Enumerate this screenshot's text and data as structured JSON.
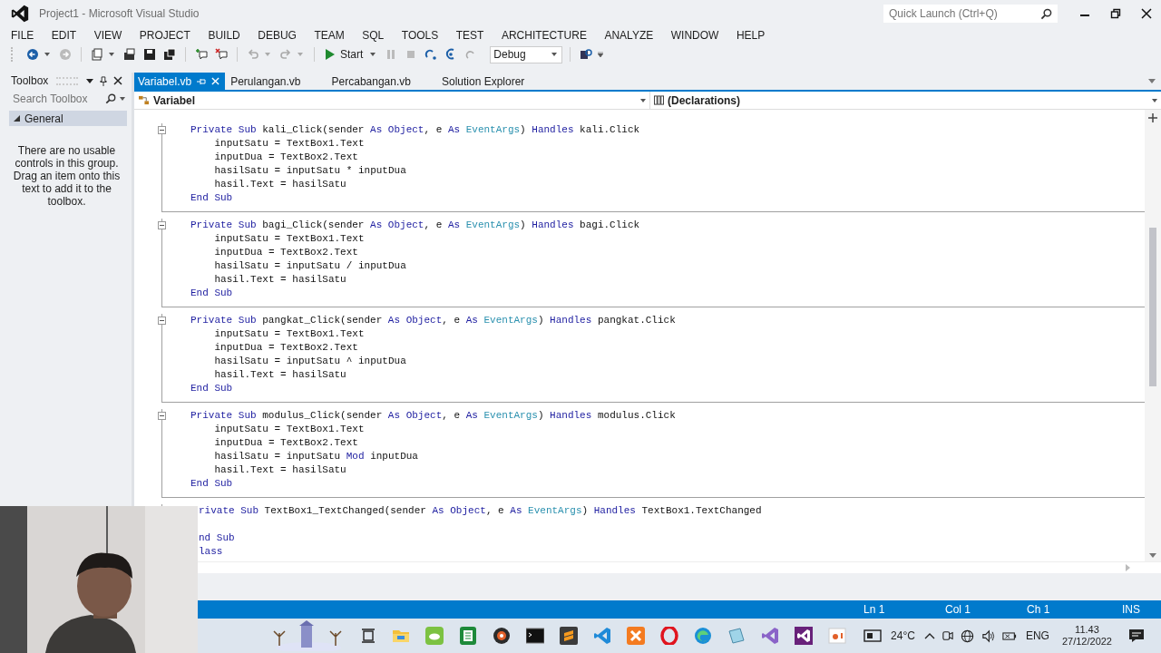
{
  "window": {
    "title": "Project1 - Microsoft Visual Studio"
  },
  "quick_launch": {
    "placeholder": "Quick Launch (Ctrl+Q)"
  },
  "menu": [
    "FILE",
    "EDIT",
    "VIEW",
    "PROJECT",
    "BUILD",
    "DEBUG",
    "TEAM",
    "SQL",
    "TOOLS",
    "TEST",
    "ARCHITECTURE",
    "ANALYZE",
    "WINDOW",
    "HELP"
  ],
  "toolbar": {
    "start_label": "Start",
    "configuration": "Debug"
  },
  "toolbox": {
    "title": "Toolbox",
    "search": {
      "placeholder": "Search Toolbox"
    },
    "group": {
      "label": "General",
      "expanded": true
    },
    "empty_message": "There are no usable controls in this group. Drag an item onto this text to add it to the toolbox."
  },
  "tabs": [
    {
      "label": "Variabel.vb",
      "selected": true
    },
    {
      "label": "Perulangan.vb",
      "selected": false
    },
    {
      "label": "Percabangan.vb",
      "selected": false
    },
    {
      "label": "Solution Explorer",
      "selected": false
    }
  ],
  "nav_bar": {
    "type": "Variabel",
    "member": "(Declarations)"
  },
  "code_blocks": [
    {
      "lines": [
        {
          "kind": "head",
          "tokens": [
            {
              "kind": "keyword",
              "text": "Private Sub"
            },
            {
              "kind": "plain",
              "text": " kali_Click(sender "
            },
            {
              "kind": "keyword",
              "text": "As Object"
            },
            {
              "kind": "plain",
              "text": ", e "
            },
            {
              "kind": "keyword",
              "text": "As"
            },
            {
              "kind": "type",
              "text": " EventArgs"
            },
            {
              "kind": "plain",
              "text": ") "
            },
            {
              "kind": "keyword",
              "text": "Handles"
            },
            {
              "kind": "plain",
              "text": " kali.Click"
            }
          ]
        },
        {
          "kind": "body",
          "tokens": [
            {
              "kind": "plain",
              "text": "inputSatu = TextBox1.Text"
            }
          ]
        },
        {
          "kind": "body",
          "tokens": [
            {
              "kind": "plain",
              "text": "inputDua = TextBox2.Text"
            }
          ]
        },
        {
          "kind": "body",
          "tokens": [
            {
              "kind": "plain",
              "text": "hasilSatu = inputSatu * inputDua"
            }
          ]
        },
        {
          "kind": "body",
          "tokens": [
            {
              "kind": "plain",
              "text": "hasil.Text = hasilSatu"
            }
          ]
        },
        {
          "kind": "end",
          "tokens": [
            {
              "kind": "keyword",
              "text": "End Sub"
            }
          ]
        }
      ]
    },
    {
      "lines": [
        {
          "kind": "head",
          "tokens": [
            {
              "kind": "keyword",
              "text": "Private Sub"
            },
            {
              "kind": "plain",
              "text": " bagi_Click(sender "
            },
            {
              "kind": "keyword",
              "text": "As Object"
            },
            {
              "kind": "plain",
              "text": ", e "
            },
            {
              "kind": "keyword",
              "text": "As"
            },
            {
              "kind": "type",
              "text": " EventArgs"
            },
            {
              "kind": "plain",
              "text": ") "
            },
            {
              "kind": "keyword",
              "text": "Handles"
            },
            {
              "kind": "plain",
              "text": " bagi.Click"
            }
          ]
        },
        {
          "kind": "body",
          "tokens": [
            {
              "kind": "plain",
              "text": "inputSatu = TextBox1.Text"
            }
          ]
        },
        {
          "kind": "body",
          "tokens": [
            {
              "kind": "plain",
              "text": "inputDua = TextBox2.Text"
            }
          ]
        },
        {
          "kind": "body",
          "tokens": [
            {
              "kind": "plain",
              "text": "hasilSatu = inputSatu / inputDua"
            }
          ]
        },
        {
          "kind": "body",
          "tokens": [
            {
              "kind": "plain",
              "text": "hasil.Text = hasilSatu"
            }
          ]
        },
        {
          "kind": "end",
          "tokens": [
            {
              "kind": "keyword",
              "text": "End Sub"
            }
          ]
        }
      ]
    },
    {
      "lines": [
        {
          "kind": "head",
          "tokens": [
            {
              "kind": "keyword",
              "text": "Private Sub"
            },
            {
              "kind": "plain",
              "text": " pangkat_Click(sender "
            },
            {
              "kind": "keyword",
              "text": "As Object"
            },
            {
              "kind": "plain",
              "text": ", e "
            },
            {
              "kind": "keyword",
              "text": "As"
            },
            {
              "kind": "type",
              "text": " EventArgs"
            },
            {
              "kind": "plain",
              "text": ") "
            },
            {
              "kind": "keyword",
              "text": "Handles"
            },
            {
              "kind": "plain",
              "text": " pangkat.Click"
            }
          ]
        },
        {
          "kind": "body",
          "tokens": [
            {
              "kind": "plain",
              "text": "inputSatu = TextBox1.Text"
            }
          ]
        },
        {
          "kind": "body",
          "tokens": [
            {
              "kind": "plain",
              "text": "inputDua = TextBox2.Text"
            }
          ]
        },
        {
          "kind": "body",
          "tokens": [
            {
              "kind": "plain",
              "text": "hasilSatu = inputSatu ^ inputDua"
            }
          ]
        },
        {
          "kind": "body",
          "tokens": [
            {
              "kind": "plain",
              "text": "hasil.Text = hasilSatu"
            }
          ]
        },
        {
          "kind": "end",
          "tokens": [
            {
              "kind": "keyword",
              "text": "End Sub"
            }
          ]
        }
      ]
    },
    {
      "lines": [
        {
          "kind": "head",
          "tokens": [
            {
              "kind": "keyword",
              "text": "Private Sub"
            },
            {
              "kind": "plain",
              "text": " modulus_Click(sender "
            },
            {
              "kind": "keyword",
              "text": "As Object"
            },
            {
              "kind": "plain",
              "text": ", e "
            },
            {
              "kind": "keyword",
              "text": "As"
            },
            {
              "kind": "type",
              "text": " EventArgs"
            },
            {
              "kind": "plain",
              "text": ") "
            },
            {
              "kind": "keyword",
              "text": "Handles"
            },
            {
              "kind": "plain",
              "text": " modulus.Click"
            }
          ]
        },
        {
          "kind": "body",
          "tokens": [
            {
              "kind": "plain",
              "text": "inputSatu = TextBox1.Text"
            }
          ]
        },
        {
          "kind": "body",
          "tokens": [
            {
              "kind": "plain",
              "text": "inputDua = TextBox2.Text"
            }
          ]
        },
        {
          "kind": "body",
          "tokens": [
            {
              "kind": "plain",
              "text": "hasilSatu = inputSatu "
            },
            {
              "kind": "keyword",
              "text": "Mod"
            },
            {
              "kind": "plain",
              "text": " inputDua"
            }
          ]
        },
        {
          "kind": "body",
          "tokens": [
            {
              "kind": "plain",
              "text": "hasil.Text = hasilSatu"
            }
          ]
        },
        {
          "kind": "end",
          "tokens": [
            {
              "kind": "keyword",
              "text": "End Sub"
            }
          ]
        }
      ]
    },
    {
      "lines": [
        {
          "kind": "cut-head",
          "tokens": [
            {
              "kind": "keyword",
              "text": "rivate Sub"
            },
            {
              "kind": "plain",
              "text": " TextBox1_TextChanged(sender "
            },
            {
              "kind": "keyword",
              "text": "As Object"
            },
            {
              "kind": "plain",
              "text": ", e "
            },
            {
              "kind": "keyword",
              "text": "As"
            },
            {
              "kind": "type",
              "text": " EventArgs"
            },
            {
              "kind": "plain",
              "text": ") "
            },
            {
              "kind": "keyword",
              "text": "Handles"
            },
            {
              "kind": "plain",
              "text": " TextBox1.TextChanged"
            }
          ]
        },
        {
          "kind": "blank"
        },
        {
          "kind": "cut-end",
          "tokens": [
            {
              "kind": "keyword",
              "text": "nd Sub"
            }
          ]
        },
        {
          "kind": "cut-end",
          "tokens": [
            {
              "kind": "keyword",
              "text": "lass"
            }
          ]
        }
      ]
    }
  ],
  "status_bar": {
    "line": "Ln 1",
    "column": "Col 1",
    "char": "Ch 1",
    "mode": "INS"
  },
  "taskbar": {
    "weather": "24°C",
    "language": "ENG",
    "time": "11.43",
    "date": "27/12/2022"
  }
}
